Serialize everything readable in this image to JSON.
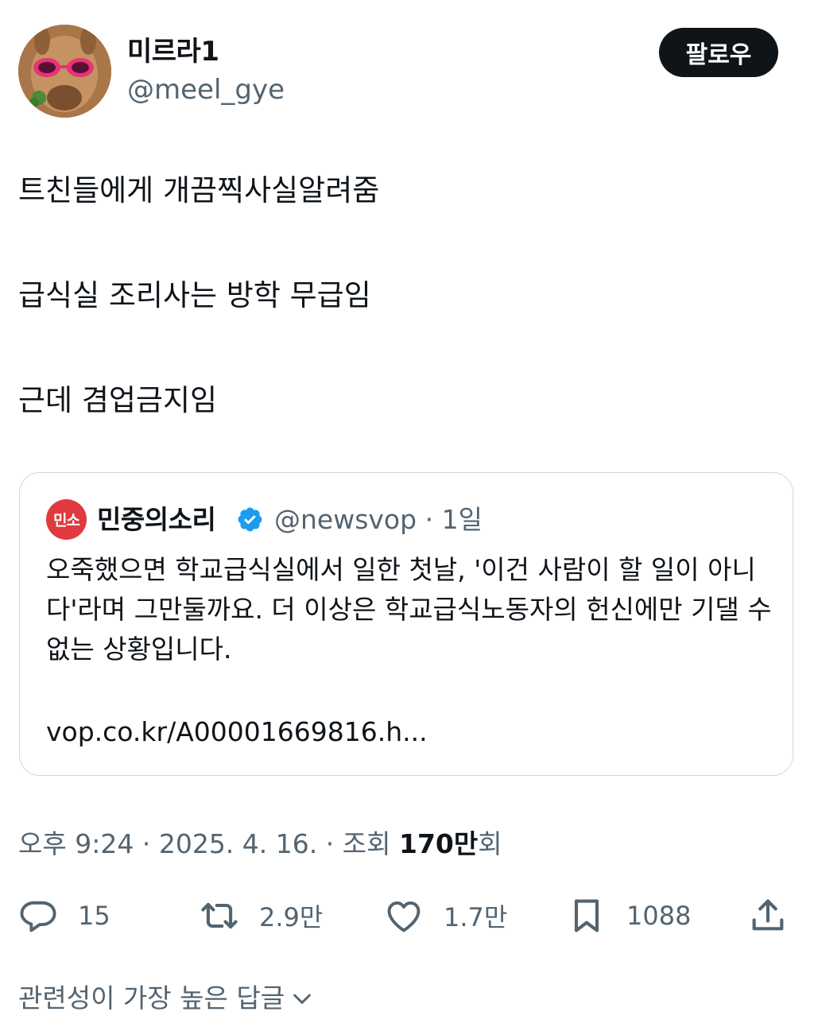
{
  "author": {
    "display_name": "미르라1",
    "handle": "@meel_gye"
  },
  "follow_button": "팔로우",
  "tweet": {
    "lines": [
      "트친들에게 개끔찍사실알려줌",
      "급식실 조리사는 방학 무급임",
      "근데 겸업금지임"
    ]
  },
  "quote": {
    "avatar_text": "민소",
    "display_name": "민중의소리",
    "handle": "@newsvop",
    "separator": "·",
    "age": "1일",
    "text": "오죽했으면 학교급식실에서 일한 첫날, '이건 사람이 할 일이 아니다'라며 그만둘까요. 더 이상은 학교급식노동자의 헌신에만 기댈 수 없는 상황입니다.",
    "link": "vop.co.kr/A00001669816.h..."
  },
  "meta": {
    "time": "오후 9:24",
    "sep1": "·",
    "date": "2025. 4. 16.",
    "sep2": "·",
    "views_label": "조회",
    "views_count": "170만",
    "views_unit": "회"
  },
  "actions": {
    "replies": "15",
    "retweets": "2.9만",
    "likes": "1.7만",
    "bookmarks": "1088"
  },
  "replies_sort_label": "관련성이 가장 높은 답글",
  "colors": {
    "text": "#0f1419",
    "secondary": "#536471",
    "verified": "#1d9bf0",
    "quote_avatar": "#e03a3e",
    "border": "#cfd9de"
  }
}
